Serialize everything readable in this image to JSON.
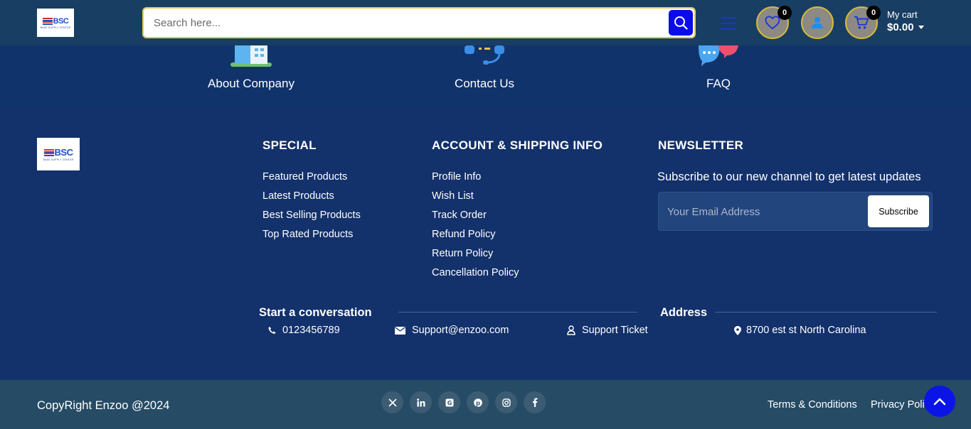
{
  "header": {
    "logo": {
      "letters": "BSC",
      "sub": "BASE SUPPLY CENTER"
    },
    "search": {
      "placeholder": "Search here..."
    },
    "wishlist_count": "0",
    "cart_count": "0",
    "cart_label": "My cart",
    "cart_total": "$0.00"
  },
  "info_strip": [
    {
      "label": "About Company"
    },
    {
      "label": "Contact Us"
    },
    {
      "label": "FAQ"
    }
  ],
  "footer": {
    "logo": {
      "letters": "BSC",
      "sub": "BASE SUPPLY CENTER"
    },
    "special": {
      "title": "SPECIAL",
      "links": [
        "Featured Products",
        "Latest Products",
        "Best Selling Products",
        "Top Rated Products"
      ]
    },
    "account": {
      "title": "ACCOUNT & SHIPPING INFO",
      "links": [
        "Profile Info",
        "Wish List",
        "Track Order",
        "Refund Policy",
        "Return Policy",
        "Cancellation Policy"
      ]
    },
    "newsletter": {
      "title": "NEWSLETTER",
      "text": "Subscribe to our new channel to get latest updates",
      "placeholder": "Your Email Address",
      "button": "Subscribe"
    },
    "conversation": {
      "title": "Start a conversation",
      "phone": "0123456789",
      "email": "Support@enzoo.com",
      "ticket": "Support Ticket"
    },
    "address": {
      "title": "Address",
      "value": "8700 est st North Carolina"
    }
  },
  "bottom": {
    "copyright": "CopyRight Enzoo @2024",
    "socials": [
      "x-icon",
      "linkedin-icon",
      "google-icon",
      "pinterest-icon",
      "instagram-icon",
      "facebook-icon"
    ],
    "terms": "Terms & Conditions",
    "privacy": "Privacy Policy"
  },
  "colors": {
    "header_bg": "#183e63",
    "footer_bg": "#13316b",
    "bottom_bg": "#264b65",
    "accent_blue": "#0a0aeb",
    "gold_border": "#d6b93a"
  }
}
